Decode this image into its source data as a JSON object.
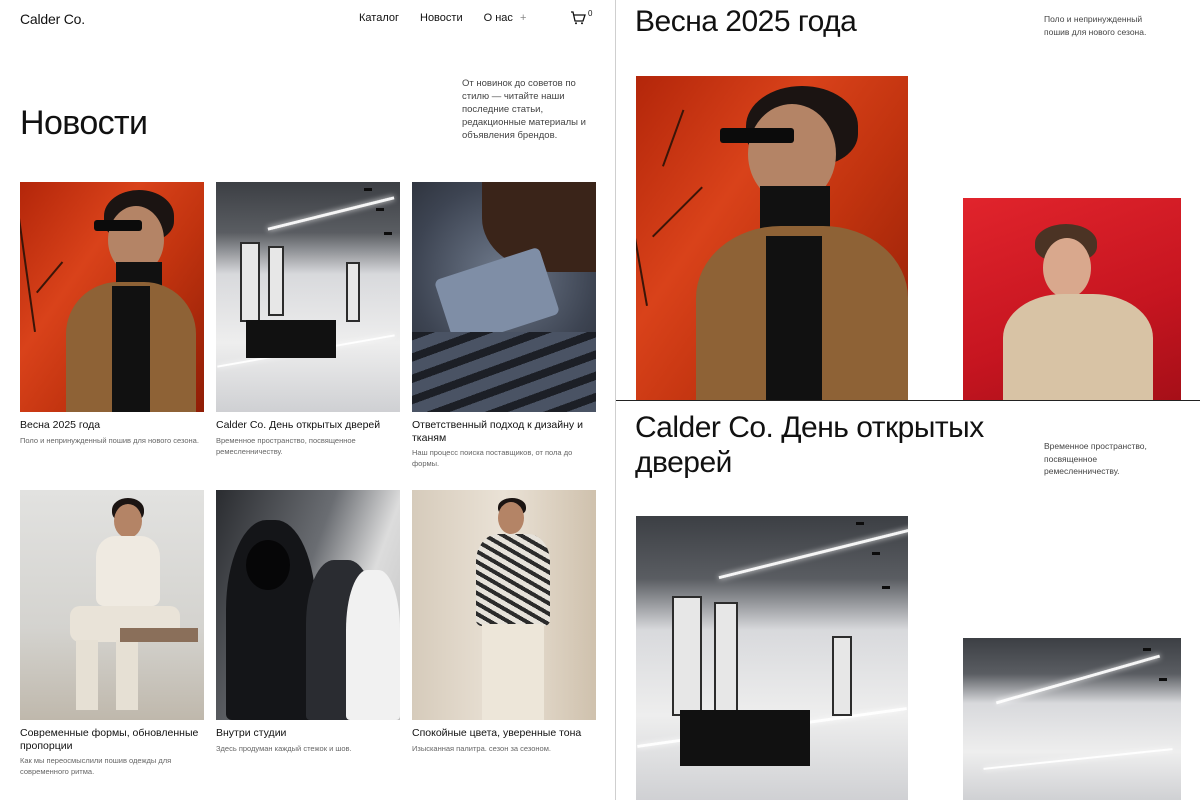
{
  "brand": {
    "name": "Calder Co."
  },
  "nav": {
    "items": [
      "Каталог",
      "Новости",
      "О нас"
    ],
    "about_plus": "+",
    "cart_count": "0"
  },
  "page": {
    "title": "Новости",
    "intro": "От новинок до советов по стилю — читайте наши последние статьи, редакционные материалы и объявления брендов."
  },
  "articles": [
    {
      "title": "Весна 2025 года",
      "desc": "Поло и непринужденный пошив для нового сезона."
    },
    {
      "title": "Calder Co. День открытых дверей",
      "desc": "Временное пространство, посвященное ремесленничеству."
    },
    {
      "title": "Ответственный подход к дизайну и тканям",
      "desc": "Наш процесс поиска поставщиков, от пола до формы."
    },
    {
      "title": "Современные формы, обновленные пропорции",
      "desc": "Как мы переосмыслили пошив одежды для современного ритма."
    },
    {
      "title": "Внутри студии",
      "desc": "Здесь продуман каждый стежок и шов."
    },
    {
      "title": "Спокойные цвета, уверенные тона",
      "desc": "Изысканная палитра. сезон за сезоном."
    }
  ],
  "detail_spring": {
    "title": "Весна 2025 года",
    "desc": "Поло и непринужденный пошив для нового сезона."
  },
  "detail_openday": {
    "title": "Calder Co. День открытых дверей",
    "desc": "Временное пространство, посвященное ремесленничеству."
  },
  "icons": {
    "cart": "cart-icon",
    "plus": "plus-icon"
  },
  "colors": {
    "text": "#111111",
    "muted": "#666666",
    "accent_orange": "#d9421a",
    "accent_red": "#e1242c"
  }
}
